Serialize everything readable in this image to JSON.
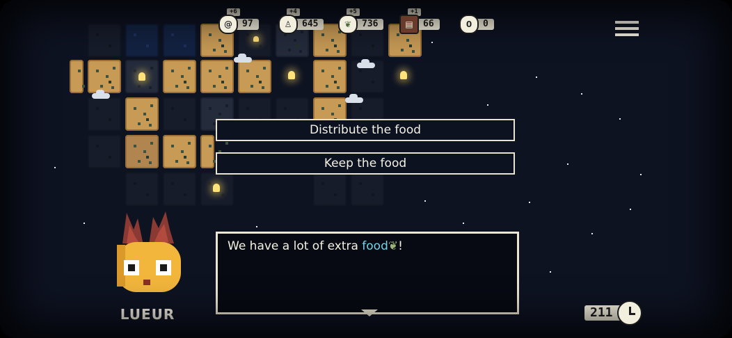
{
  "resources": [
    {
      "name": "spirit",
      "icon": "spiral-icon",
      "delta": "+6",
      "value": "97"
    },
    {
      "name": "population",
      "icon": "person-icon",
      "delta": "+4",
      "value": "645"
    },
    {
      "name": "food",
      "icon": "leaf-icon",
      "delta": "+5",
      "value": "736"
    },
    {
      "name": "materials",
      "icon": "crate-icon",
      "delta": "+1",
      "value": "66"
    },
    {
      "name": "tokens",
      "icon": "coin-icon",
      "delta": "",
      "value": "0"
    }
  ],
  "choices": {
    "distribute": "Distribute the food",
    "keep": "Keep the food"
  },
  "dialog": {
    "text_before": "We have a lot of extra ",
    "highlight": "food",
    "text_after": "!"
  },
  "character": {
    "name": "LUEUR"
  },
  "timer": {
    "value": "211"
  },
  "colors": {
    "panel": "#f3efde",
    "highlight": "#74d3e8",
    "tile_lit": "#c79a55",
    "background": "#0e1322"
  }
}
